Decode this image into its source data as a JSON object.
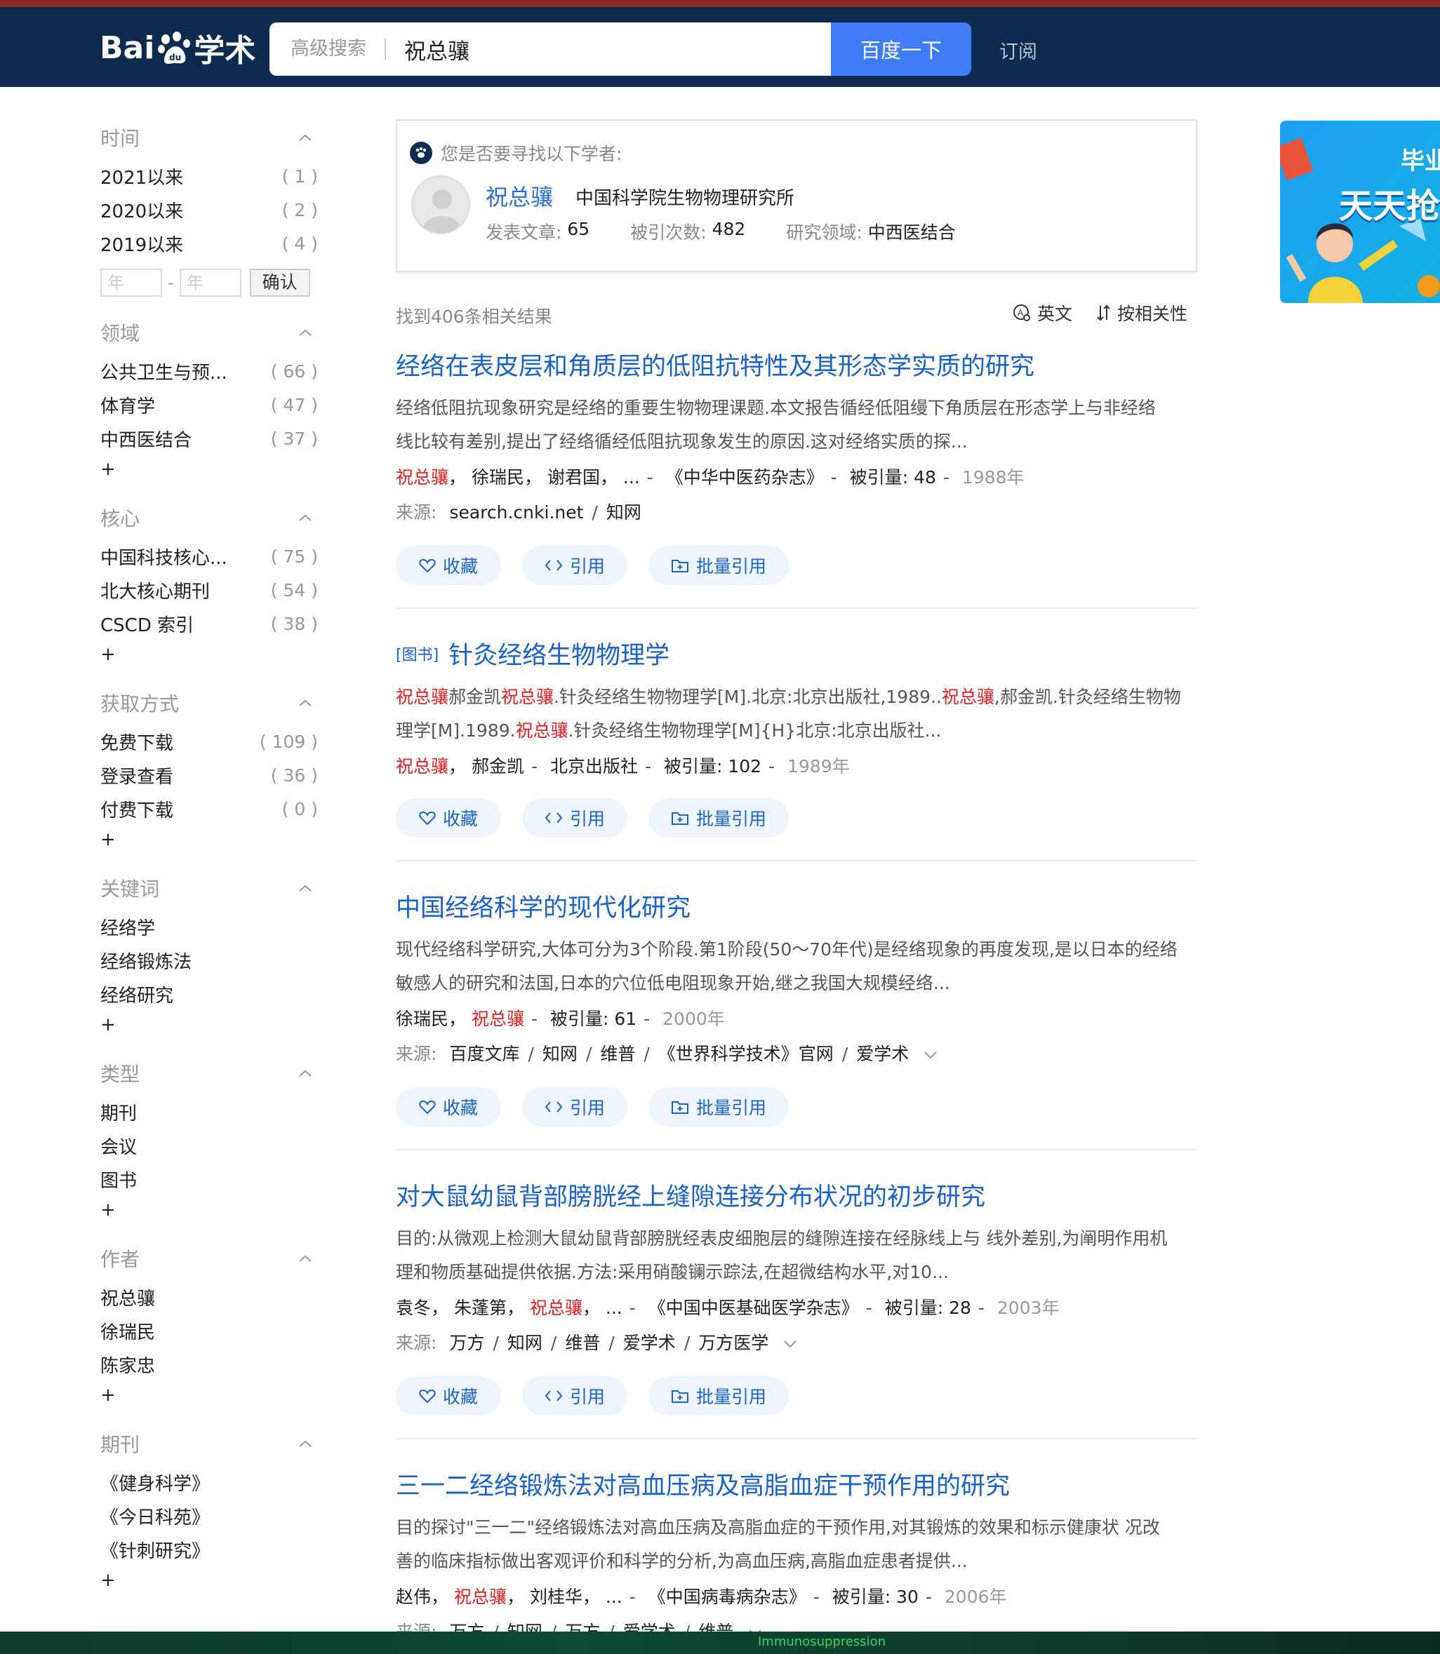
{
  "header": {
    "logo": "Bai学术",
    "logo_prefix": "Bai",
    "logo_suffix": "学术",
    "advanced_search": "高级搜索",
    "query": "祝总骧",
    "search_button": "百度一下",
    "subscribe": "订阅"
  },
  "sidebar": {
    "time": {
      "title": "时间",
      "items": [
        {
          "label": "2021以来",
          "count": "( 1 )"
        },
        {
          "label": "2020以来",
          "count": "( 2 )"
        },
        {
          "label": "2019以来",
          "count": "( 4 )"
        }
      ],
      "year_placeholder": "年",
      "dash": "-",
      "confirm": "确认"
    },
    "field": {
      "title": "领域",
      "items": [
        {
          "label": "公共卫生与预...",
          "count": "( 66 )"
        },
        {
          "label": "体育学",
          "count": "( 47 )"
        },
        {
          "label": "中西医结合",
          "count": "( 37 )"
        }
      ],
      "more": "+"
    },
    "core": {
      "title": "核心",
      "items": [
        {
          "label": "中国科技核心...",
          "count": "( 75 )"
        },
        {
          "label": "北大核心期刊",
          "count": "( 54 )"
        },
        {
          "label": "CSCD 索引",
          "count": "( 38 )"
        }
      ],
      "more": "+"
    },
    "access": {
      "title": "获取方式",
      "items": [
        {
          "label": "免费下载",
          "count": "( 109 )"
        },
        {
          "label": "登录查看",
          "count": "( 36 )"
        },
        {
          "label": "付费下载",
          "count": "( 0 )"
        }
      ],
      "more": "+"
    },
    "keywords": {
      "title": "关键词",
      "items": [
        {
          "label": "经络学"
        },
        {
          "label": "经络锻炼法"
        },
        {
          "label": "经络研究"
        }
      ],
      "more": "+"
    },
    "type": {
      "title": "类型",
      "items": [
        {
          "label": "期刊"
        },
        {
          "label": "会议"
        },
        {
          "label": "图书"
        }
      ],
      "more": "+"
    },
    "author": {
      "title": "作者",
      "items": [
        {
          "label": "祝总骧"
        },
        {
          "label": "徐瑞民"
        },
        {
          "label": "陈家忠"
        }
      ],
      "more": "+"
    },
    "journal": {
      "title": "期刊",
      "items": [
        {
          "label": "《健身科学》"
        },
        {
          "label": "《今日科苑》"
        },
        {
          "label": "《针刺研究》"
        }
      ],
      "more": "+"
    }
  },
  "scholar_box": {
    "question": "您是否要寻找以下学者:",
    "name": "祝总骧",
    "institution": "中国科学院生物物理研究所",
    "papers_label": "发表文章:",
    "papers": "65",
    "citations_label": "被引次数:",
    "citations": "482",
    "field_label": "研究领域:",
    "field": "中西医结合"
  },
  "results_meta": {
    "found": "找到406条相关结果",
    "english": "英文",
    "sort": "按相关性"
  },
  "actions": {
    "collect": "收藏",
    "cite": "引用",
    "batch_cite": "批量引用"
  },
  "results": [
    {
      "title": "经络在表皮层和角质层的低阻抗特性及其形态学实质的研究",
      "abstract_line1": "经络低阻抗现象研究是经络的重要生物物理课题.本文报告循经低阻缦下角质层在形态学上与非经络",
      "abstract_line2": "线比较有差别,提出了经络循经低阻抗现象发生的原因.这对经络实质的探...",
      "author1": "祝总骧",
      "author2": "徐瑞民",
      "author3": "谢君国",
      "ellipsis": "...",
      "journal": "《中华中医药杂志》",
      "cited": "被引量: 48",
      "year": "1988年",
      "source_label": "来源:",
      "source1": "search.cnki.net",
      "source2": "知网"
    },
    {
      "badge": "[图书]",
      "title": "针灸经络生物物理学",
      "abstract_line1_a": "祝总骧",
      "abstract_line1_b": "郝金凯",
      "abstract_line1_c": "祝总骧",
      "abstract_line1_d": ".针灸经络生物物理学[M].北京:北京出版社,1989..",
      "abstract_line1_e": "祝总骧",
      "abstract_line1_f": ",郝金凯.针灸经络生物物",
      "abstract_line2_a": "理学[M].1989.",
      "abstract_line2_b": "祝总骧",
      "abstract_line2_c": ".针灸经络生物物理学[M]{H}北京:北京出版社...",
      "author1": "祝总骧",
      "author2": "郝金凯",
      "publisher": "北京出版社",
      "cited": "被引量: 102",
      "year": "1989年"
    },
    {
      "title": "中国经络科学的现代化研究",
      "abstract_line1": "现代经络科学研究,大体可分为3个阶段.第1阶段(50～70年代)是经络现象的再度发现,是以日本的经络",
      "abstract_line2": "敏感人的研究和法国,日本的穴位低电阻现象开始,继之我国大规模经络...",
      "author1": "徐瑞民",
      "author2": "祝总骧",
      "cited": "被引量: 61",
      "year": "2000年",
      "source_label": "来源:",
      "sources": [
        "百度文库",
        "知网",
        "维普",
        "《世界科学技术》官网",
        "爱学术"
      ]
    },
    {
      "title": "对大鼠幼鼠背部膀胱经上缝隙连接分布状况的初步研究",
      "abstract_line1": "目的:从微观上检测大鼠幼鼠背部膀胱经表皮细胞层的缝隙连接在经脉线上与 线外差别,为阐明作用机",
      "abstract_line2": "理和物质基础提供依据.方法:采用硝酸镧示踪法,在超微结构水平,对10...",
      "author1": "袁冬",
      "author2": "朱蓬第",
      "author3": "祝总骧",
      "ellipsis": "...",
      "journal": "《中国中医基础医学杂志》",
      "cited": "被引量: 28",
      "year": "2003年",
      "source_label": "来源:",
      "sources": [
        "万方",
        "知网",
        "维普",
        "爱学术",
        "万方医学"
      ]
    },
    {
      "title": "三一二经络锻炼法对高血压病及高脂血症干预作用的研究",
      "abstract_line1": "目的探讨\"三一二\"经络锻炼法对高血压病及高脂血症的干预作用,对其锻炼的效果和标示健康状 况改",
      "abstract_line2": "善的临床指标做出客观评价和科学的分析,为高血压病,高脂血症患者提供...",
      "author1": "赵伟",
      "author2": "祝总骧",
      "author3": "刘桂华",
      "ellipsis": "...",
      "journal": "《中国病毒病杂志》",
      "cited": "被引量: 30",
      "year": "2006年",
      "source_label": "来源:",
      "sources": [
        "万方",
        "知网",
        "万方",
        "爱学术",
        "维普"
      ]
    }
  ],
  "ad": {
    "line1": "毕业",
    "line2": "天天抢"
  },
  "bottom_bar": "Immunosuppression",
  "colors": {
    "header_bg": "#0d2b4e",
    "search_button": "#3f7cf5",
    "title_link": "#1a62c6",
    "highlight": "#e02020"
  }
}
